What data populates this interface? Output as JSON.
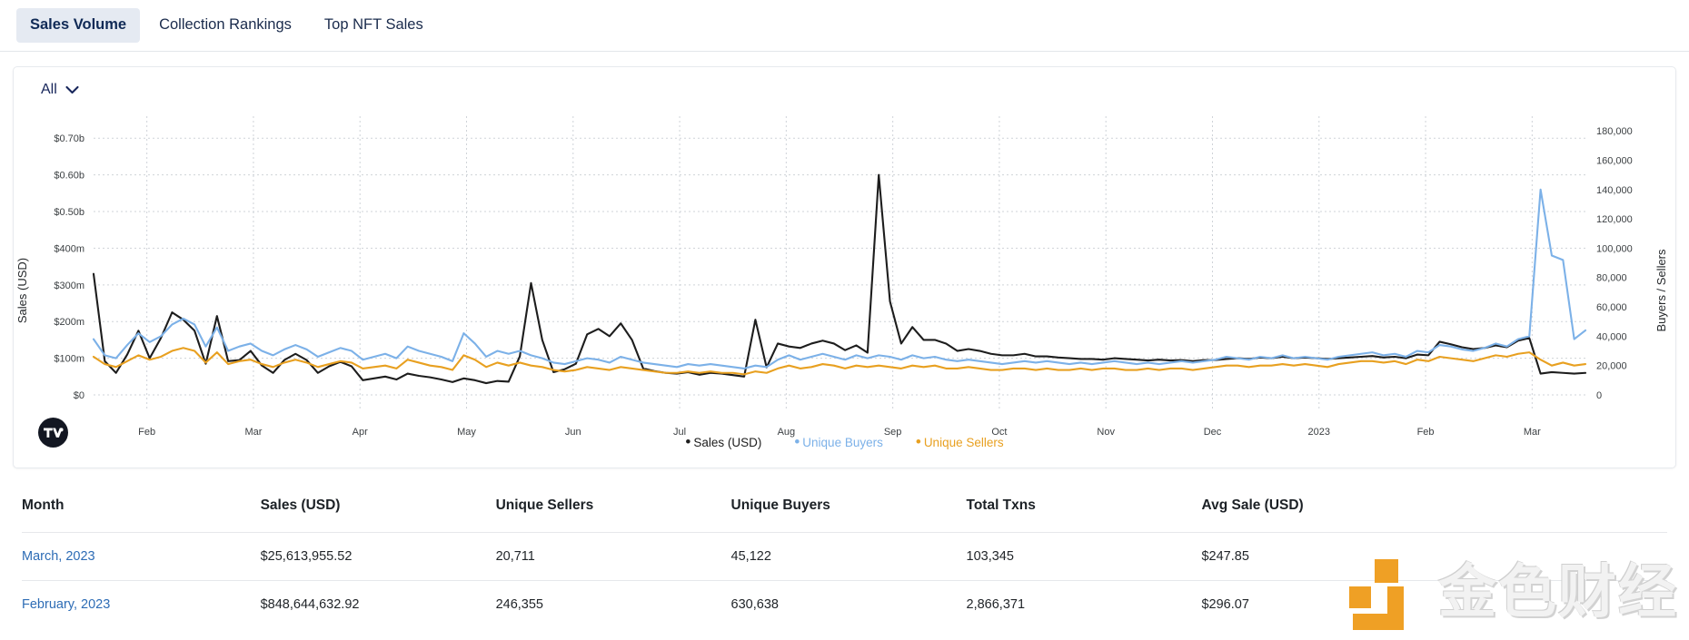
{
  "tabs": [
    {
      "label": "Sales Volume",
      "active": true
    },
    {
      "label": "Collection Rankings",
      "active": false
    },
    {
      "label": "Top NFT Sales",
      "active": false
    }
  ],
  "chart_card": {
    "range_selector": {
      "value": "All",
      "icon": "chevron-down-icon"
    },
    "attribution_logo": "tradingview-logo"
  },
  "chart_data": {
    "type": "line",
    "title": "",
    "xlabel": "",
    "ylabel": "Sales (USD)",
    "y2label": "Buyers / Sellers",
    "grid": true,
    "legend_position": "bottom-center",
    "x_tick_labels": [
      "Feb",
      "Mar",
      "Apr",
      "May",
      "Jun",
      "Jul",
      "Aug",
      "Sep",
      "Oct",
      "Nov",
      "Dec",
      "2023",
      "Feb",
      "Mar"
    ],
    "y_tick_labels": [
      "$0.70b",
      "$0.60b",
      "$0.50b",
      "$400m",
      "$300m",
      "$200m",
      "$100m",
      "$0"
    ],
    "y_tick_values": [
      700000000,
      600000000,
      500000000,
      400000000,
      300000000,
      200000000,
      100000000,
      0
    ],
    "ylim": [
      0,
      760000000
    ],
    "y2_tick_labels": [
      "180,000",
      "160,000",
      "140,000",
      "120,000",
      "100,000",
      "80,000",
      "60,000",
      "40,000",
      "20,000",
      "0"
    ],
    "y2_tick_values": [
      180000,
      160000,
      140000,
      120000,
      100000,
      80000,
      60000,
      40000,
      20000,
      0
    ],
    "y2lim": [
      0,
      190000
    ],
    "colors": {
      "sales": "#1d1d1d",
      "buyers": "#7cb1e8",
      "sellers": "#e8a020"
    },
    "series": [
      {
        "name": "Sales (USD)",
        "axis": "left",
        "color": "#1d1d1d",
        "values": [
          330,
          92,
          60,
          110,
          175,
          100,
          155,
          225,
          205,
          175,
          85,
          215,
          92,
          95,
          120,
          80,
          60,
          95,
          112,
          95,
          60,
          78,
          90,
          78,
          40,
          45,
          50,
          42,
          58,
          52,
          48,
          42,
          35,
          45,
          40,
          32,
          38,
          36,
          105,
          305,
          150,
          62,
          70,
          85,
          165,
          180,
          160,
          195,
          150,
          72,
          65,
          60,
          58,
          62,
          55,
          60,
          58,
          54,
          50,
          205,
          75,
          140,
          132,
          128,
          140,
          148,
          140,
          122,
          135,
          115,
          600,
          255,
          140,
          185,
          150,
          150,
          140,
          120,
          125,
          120,
          112,
          108,
          108,
          112,
          105,
          105,
          102,
          100,
          98,
          98,
          96,
          100,
          98,
          96,
          94,
          96,
          94,
          95,
          92,
          95,
          95,
          98,
          100,
          98,
          102,
          100,
          104,
          100,
          102,
          100,
          98,
          100,
          102,
          104,
          106,
          102,
          104,
          100,
          110,
          108,
          145,
          138,
          130,
          125,
          128,
          135,
          130,
          148,
          155,
          58,
          62,
          60,
          58,
          60
        ]
      },
      {
        "name": "Unique Buyers",
        "axis": "right",
        "color": "#7cb1e8",
        "values": [
          38000,
          27000,
          25000,
          34000,
          42000,
          36000,
          40000,
          48000,
          52000,
          48000,
          33000,
          46000,
          30000,
          33000,
          35000,
          30000,
          27000,
          31000,
          34000,
          31000,
          26000,
          29000,
          32000,
          30000,
          24000,
          26000,
          28000,
          25000,
          33000,
          30000,
          28000,
          26000,
          23000,
          42000,
          35000,
          26000,
          30000,
          28000,
          30000,
          27000,
          25000,
          22000,
          21000,
          23000,
          25000,
          24000,
          22000,
          26000,
          24000,
          22000,
          21000,
          20000,
          19000,
          21000,
          20000,
          21000,
          20000,
          19000,
          18000,
          20000,
          19000,
          24000,
          27000,
          24000,
          26000,
          28000,
          26000,
          24000,
          27000,
          25000,
          27000,
          26000,
          24000,
          27000,
          25000,
          26000,
          24000,
          23000,
          24000,
          23000,
          22000,
          21000,
          22000,
          23000,
          22000,
          23000,
          22000,
          21000,
          22000,
          21000,
          22000,
          23000,
          22000,
          21000,
          22000,
          21000,
          22000,
          23000,
          22000,
          23000,
          24000,
          26000,
          25000,
          24000,
          26000,
          25000,
          27000,
          25000,
          26000,
          25000,
          24000,
          26000,
          27000,
          28000,
          29000,
          27000,
          28000,
          26000,
          30000,
          29000,
          34000,
          33000,
          31000,
          30000,
          32000,
          35000,
          33000,
          38000,
          40000,
          140000,
          95000,
          92000,
          38000,
          44000
        ]
      },
      {
        "name": "Unique Sellers",
        "axis": "right",
        "color": "#e8a020",
        "values": [
          26000,
          21000,
          19000,
          23000,
          27000,
          24000,
          26000,
          30000,
          32000,
          30000,
          22000,
          29000,
          21000,
          23000,
          24000,
          21000,
          19000,
          22000,
          24000,
          22000,
          19000,
          21000,
          23000,
          22000,
          18000,
          19000,
          20000,
          18000,
          24000,
          22000,
          20000,
          19000,
          17000,
          27000,
          24000,
          19000,
          22000,
          20000,
          22000,
          20000,
          19000,
          17000,
          16000,
          17000,
          19000,
          18000,
          17000,
          19000,
          18000,
          17000,
          16000,
          15000,
          15000,
          16000,
          15000,
          16000,
          15000,
          15000,
          14000,
          16000,
          15000,
          18000,
          20000,
          18000,
          19000,
          21000,
          20000,
          18000,
          20000,
          19000,
          20000,
          19000,
          18000,
          20000,
          19000,
          20000,
          18000,
          18000,
          19000,
          18000,
          17000,
          17000,
          18000,
          18000,
          17000,
          18000,
          17000,
          17000,
          18000,
          17000,
          18000,
          18000,
          17000,
          17000,
          18000,
          17000,
          18000,
          18000,
          17000,
          18000,
          19000,
          20000,
          20000,
          19000,
          20000,
          20000,
          21000,
          20000,
          21000,
          20000,
          19000,
          21000,
          22000,
          23000,
          23000,
          22000,
          23000,
          21000,
          24000,
          23000,
          26000,
          25000,
          24000,
          23000,
          25000,
          27000,
          26000,
          28000,
          29000,
          24000,
          20000,
          22000,
          20000,
          21000
        ]
      }
    ],
    "legend": [
      {
        "label": "Sales (USD)",
        "color": "#1d1d1d"
      },
      {
        "label": "Unique Buyers",
        "color": "#7cb1e8"
      },
      {
        "label": "Unique Sellers",
        "color": "#e8a020"
      }
    ]
  },
  "table": {
    "columns": [
      "Month",
      "Sales (USD)",
      "Unique Sellers",
      "Unique Buyers",
      "Total Txns",
      "Avg Sale (USD)"
    ],
    "rows": [
      {
        "month": "March, 2023",
        "sales": "$25,613,955.52",
        "unique_sellers": "20,711",
        "unique_buyers": "45,122",
        "total_txns": "103,345",
        "avg_sale": "$247.85"
      },
      {
        "month": "February, 2023",
        "sales": "$848,644,632.92",
        "unique_sellers": "246,355",
        "unique_buyers": "630,638",
        "total_txns": "2,866,371",
        "avg_sale": "$296.07"
      }
    ]
  },
  "watermark": {
    "text": "金色财经",
    "logo_color": "#efa025"
  }
}
